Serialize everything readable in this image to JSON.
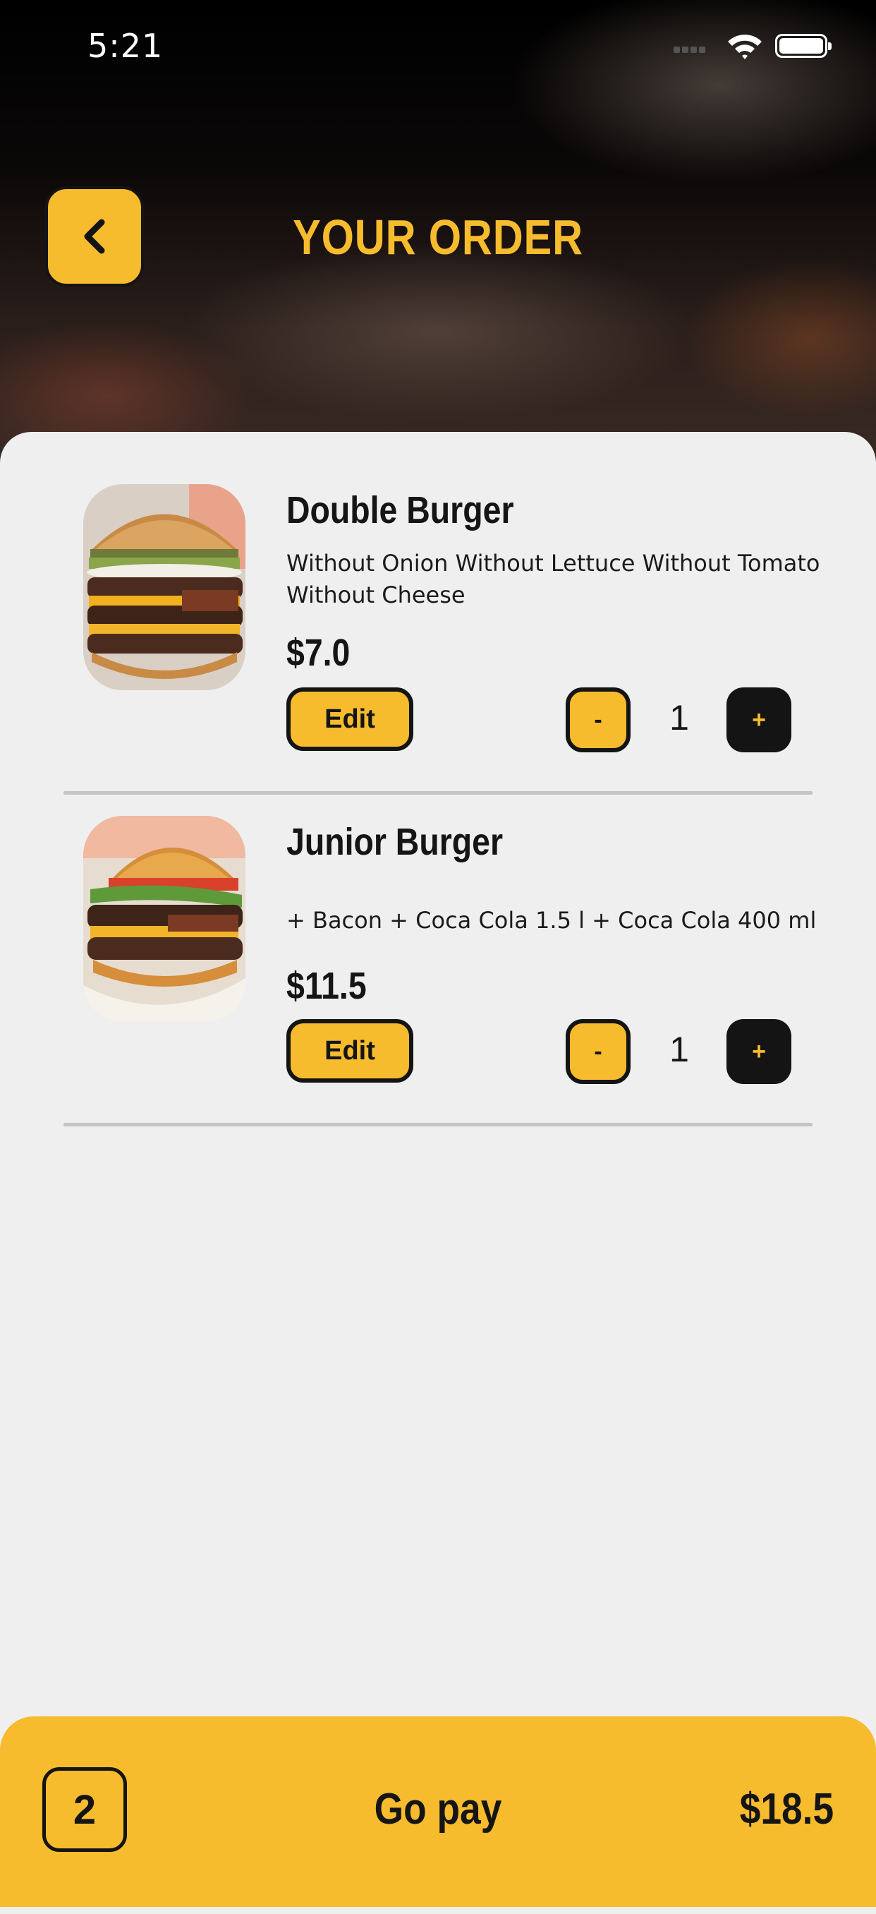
{
  "status_bar": {
    "time": "5:21"
  },
  "header": {
    "title": "YOUR ORDER",
    "back_icon": "chevron-left-icon"
  },
  "order_items": [
    {
      "name": "Double Burger",
      "options": "Without Onion Without Lettuce Without Tomato Without Cheese",
      "price": "$7.0",
      "edit_label": "Edit",
      "minus_label": "-",
      "quantity": "1",
      "plus_label": "+"
    },
    {
      "name": "Junior Burger",
      "options": "+ Bacon + Coca Cola 1.5 l + Coca Cola 400 ml",
      "price": "$11.5",
      "edit_label": "Edit",
      "minus_label": "-",
      "quantity": "1",
      "plus_label": "+"
    }
  ],
  "pay_bar": {
    "item_count": "2",
    "label": "Go pay",
    "total": "$18.5"
  },
  "colors": {
    "accent": "#f7bb2e",
    "dark": "#141414",
    "background": "#efefef"
  }
}
